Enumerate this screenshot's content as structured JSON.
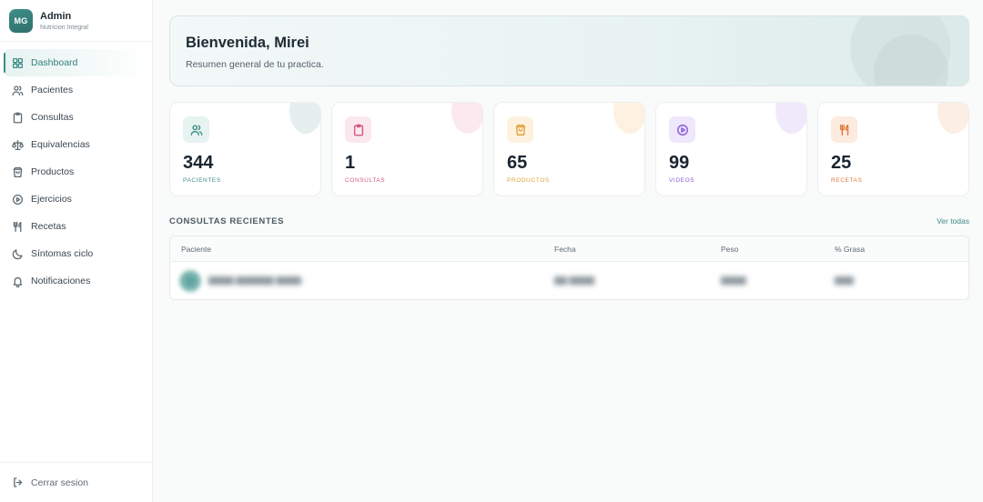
{
  "brand": {
    "avatar_initials": "MG",
    "title": "Admin",
    "subtitle": "Nutricion Integral"
  },
  "sidebar": {
    "items": [
      {
        "label": "Dashboard",
        "icon": "grid-icon",
        "active": true
      },
      {
        "label": "Pacientes",
        "icon": "users-icon"
      },
      {
        "label": "Consultas",
        "icon": "clipboard-icon"
      },
      {
        "label": "Equivalencias",
        "icon": "scale-icon"
      },
      {
        "label": "Productos",
        "icon": "shopping-bag-icon"
      },
      {
        "label": "Ejercicios",
        "icon": "play-circle-icon"
      },
      {
        "label": "Recetas",
        "icon": "utensils-icon"
      },
      {
        "label": "Síntomas ciclo",
        "icon": "moon-icon"
      },
      {
        "label": "Notificaciones",
        "icon": "bell-icon"
      }
    ],
    "logout_label": "Cerrar sesion"
  },
  "welcome": {
    "title": "Bienvenida, Mirei",
    "subtitle": "Resumen general de tu practica."
  },
  "stats": [
    {
      "value": "344",
      "label": "PACIENTES",
      "icon": "users-icon",
      "color": "#3d8d86",
      "bg": "#e6f3f1",
      "blob": "#e4efee"
    },
    {
      "value": "1",
      "label": "CONSULTAS",
      "icon": "clipboard-icon",
      "color": "#d4587e",
      "bg": "#fbe8ee",
      "blob": "#fbe9ef"
    },
    {
      "value": "65",
      "label": "PRODUCTOS",
      "icon": "shopping-bag-icon",
      "color": "#e0a23a",
      "bg": "#fdf2df",
      "blob": "#fdf1e1"
    },
    {
      "value": "99",
      "label": "VIDEOS",
      "icon": "play-circle-icon",
      "color": "#8a5bd6",
      "bg": "#efe7fb",
      "blob": "#f0e9fb"
    },
    {
      "value": "25",
      "label": "RECETAS",
      "icon": "utensils-icon",
      "color": "#e0783a",
      "bg": "#fdebdf",
      "blob": "#fdeee3"
    }
  ],
  "recent": {
    "title": "CONSULTAS RECIENTES",
    "link": "Ver todas",
    "columns": [
      "Paciente",
      "Fecha",
      "Peso",
      "% Grasa"
    ]
  },
  "colors": {
    "accent": "#3d8d86"
  }
}
